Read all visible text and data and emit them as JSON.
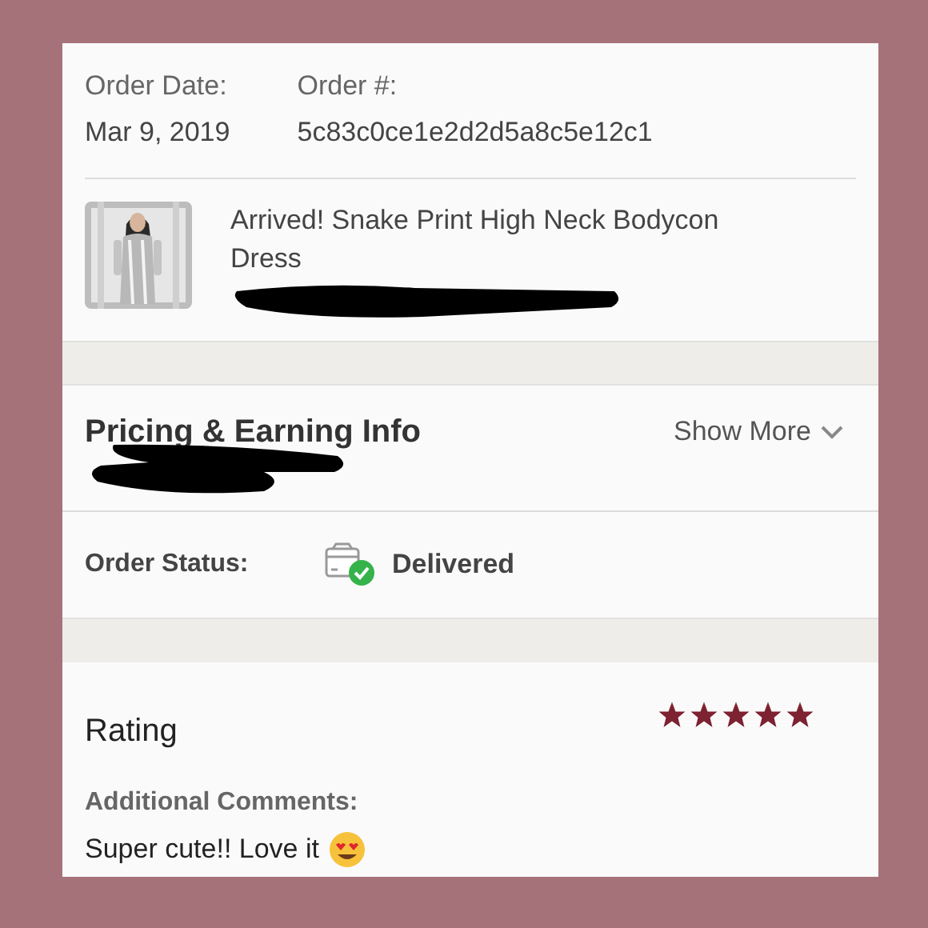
{
  "order": {
    "date_label": "Order Date:",
    "date": "Mar 9, 2019",
    "number_label": "Order #:",
    "number": "5c83c0ce1e2d2d5a8c5e12c1"
  },
  "item": {
    "kind": "picture",
    "title": "Arrived! Snake Print High Neck Bodycon Dress"
  },
  "pricing": {
    "title": "Pricing & Earning Info",
    "toggle": "Show More"
  },
  "status": {
    "label": "Order Status:",
    "value": "Delivered"
  },
  "rating": {
    "title": "Rating",
    "stars": 5,
    "comments_label": "Additional Comments:",
    "comment": "Super cute!! Love it"
  }
}
